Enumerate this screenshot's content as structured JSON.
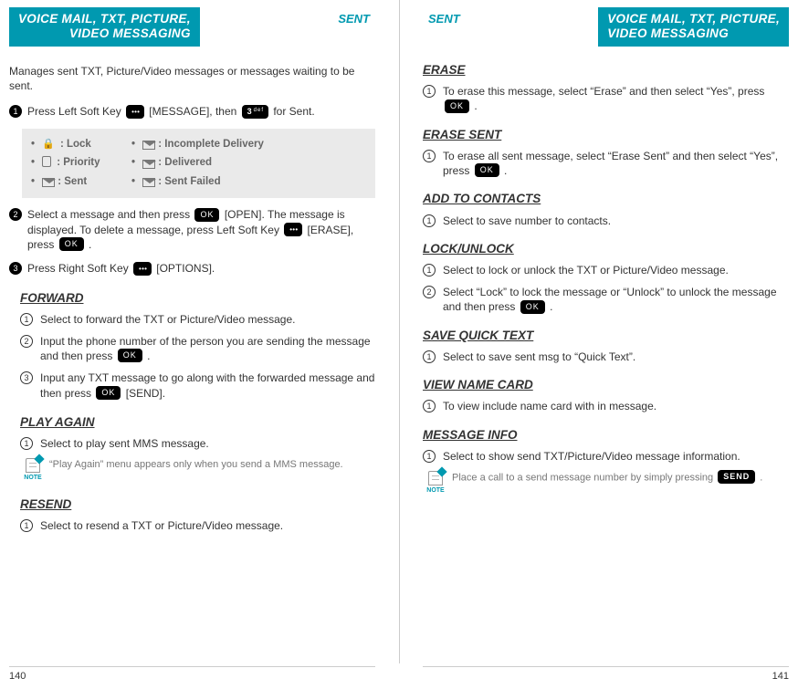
{
  "tabs": {
    "voice_mail_line1": "VOICE MAIL, TXT, PICTURE,",
    "voice_mail_line2": "VIDEO MESSAGING",
    "sent": "SENT"
  },
  "left": {
    "intro": "Manages sent TXT, Picture/Video messages or messages waiting to be sent.",
    "step1_a": "Press Left Soft Key ",
    "step1_b": " [MESSAGE], then ",
    "step1_c": " for Sent.",
    "legend": {
      "lock": ": Lock",
      "priority": ": Priority",
      "sent": ": Sent",
      "incomplete": ": Incomplete Delivery",
      "delivered": ": Delivered",
      "failed": ": Sent Failed"
    },
    "step2_a": "Select a message and then press ",
    "step2_b": " [OPEN]. The message is displayed. To delete a message, press Left Soft Key ",
    "step2_c": " [ERASE], press ",
    "step2_d": " .",
    "step3_a": "Press Right Soft Key ",
    "step3_b": " [OPTIONS].",
    "forward": {
      "title": "FORWARD",
      "s1": "Select to forward the TXT or Picture/Video message.",
      "s2a": "Input the phone number of the person you are sending the message and then press ",
      "s2b": " .",
      "s3a": "Input any TXT message to go along with the forwarded message and then press ",
      "s3b": " [SEND]."
    },
    "play_again": {
      "title": "PLAY AGAIN",
      "s1": "Select to play sent MMS message.",
      "note": "“Play Again” menu appears only when you send a MMS message."
    },
    "resend": {
      "title": "RESEND",
      "s1": "Select to resend a TXT or Picture/Video message."
    },
    "page_num": "140"
  },
  "right": {
    "erase": {
      "title": "ERASE",
      "s1a": "To erase this message, select “Erase” and then select “Yes”, press ",
      "s1b": " ."
    },
    "erase_sent": {
      "title": "ERASE SENT",
      "s1a": "To erase all sent message, select “Erase Sent” and then select “Yes”, press ",
      "s1b": " ."
    },
    "add_contacts": {
      "title": "ADD TO CONTACTS",
      "s1": "Select to save number to contacts."
    },
    "lock_unlock": {
      "title": "LOCK/UNLOCK",
      "s1": "Select to lock or unlock the TXT or Picture/Video message.",
      "s2a": "Select “Lock” to lock the message or “Unlock” to unlock the message and then press ",
      "s2b": " ."
    },
    "save_quick": {
      "title": "SAVE QUICK TEXT",
      "s1": "Select to save sent msg to “Quick Text”."
    },
    "view_name": {
      "title": "VIEW NAME CARD",
      "s1": "To view include name card with in message."
    },
    "message_info": {
      "title": "MESSAGE INFO",
      "s1": "Select to show send TXT/Picture/Video message information.",
      "note_a": "Place a call to a send message number by simply pressing ",
      "note_b": " ."
    },
    "page_num": "141"
  },
  "keys": {
    "ok": "OK",
    "send": "SEND",
    "three_sup": "def"
  },
  "note_label": "NOTE"
}
